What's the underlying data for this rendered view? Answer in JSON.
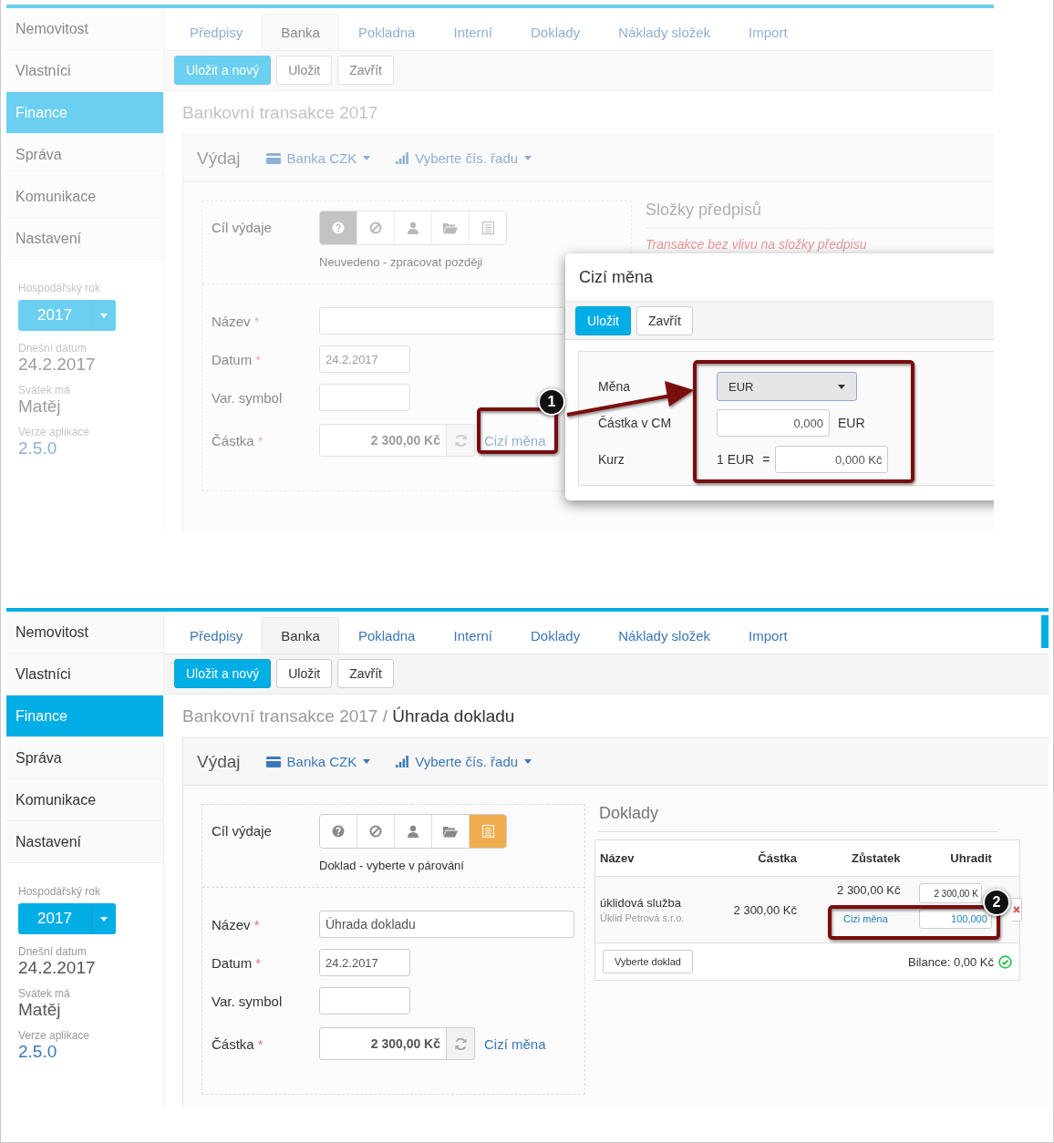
{
  "screens": [
    {
      "sidebar": {
        "items": [
          {
            "label": "Nemovitost",
            "selected": false
          },
          {
            "label": "Vlastníci",
            "selected": false
          },
          {
            "label": "Finance",
            "selected": true
          },
          {
            "label": "Správa",
            "selected": false
          },
          {
            "label": "Komunikace",
            "selected": false
          },
          {
            "label": "Nastavení",
            "selected": false
          }
        ],
        "year_label": "Hospodářský rok",
        "year": "2017",
        "info": [
          {
            "label": "Dnešní datum",
            "value": "24.2.2017",
            "kind": "plain"
          },
          {
            "label": "Svátek má",
            "value": "Matěj",
            "kind": "plain"
          },
          {
            "label": "Verze aplikace",
            "value": "2.5.0",
            "kind": "link"
          }
        ]
      },
      "tabs": [
        {
          "label": "Předpisy",
          "selected": false
        },
        {
          "label": "Banka",
          "selected": true
        },
        {
          "label": "Pokladna",
          "selected": false
        },
        {
          "label": "Interní",
          "selected": false
        },
        {
          "label": "Doklady",
          "selected": false
        },
        {
          "label": "Náklady složek",
          "selected": false
        },
        {
          "label": "Import",
          "selected": false
        }
      ],
      "toolbar": [
        {
          "label": "Uložit a nový",
          "kind": "primary"
        },
        {
          "label": "Uložit",
          "kind": "default"
        },
        {
          "label": "Zavřít",
          "kind": "default"
        }
      ],
      "breadcrumb": [
        {
          "text": "Bankovní transakce 2017",
          "kind": "parent"
        }
      ],
      "panel_header": {
        "title": "Výdaj",
        "bank": "Banka CZK",
        "series": "Vyberte čís. řadu"
      },
      "target": {
        "label": "Cíl výdaje",
        "options": [
          {
            "kind": "question",
            "selected": true
          },
          {
            "kind": "ban",
            "selected": false
          },
          {
            "kind": "person",
            "selected": false
          },
          {
            "kind": "folder",
            "selected": false
          },
          {
            "kind": "list",
            "selected": false
          }
        ],
        "note": "Neuvedeno - zpracovat později"
      },
      "fields": [
        {
          "label": "Název",
          "required_mark": "*",
          "kind": "wide"
        },
        {
          "label": "Datum",
          "required_mark": "*",
          "value": "24.2.2017",
          "kind": "short"
        },
        {
          "label": "Var. symbol",
          "kind": "short"
        },
        {
          "label": "Částka",
          "required_mark": "*",
          "value": "2 300,00 Kč",
          "kind": "amount",
          "link": "Cizí měna"
        }
      ],
      "right": {
        "kind": "components",
        "title": "Složky předpisů",
        "note": "Transakce bez vlivu na složky předpisu"
      },
      "modal": {
        "title": "Cizí měna",
        "buttons": [
          {
            "label": "Uložit",
            "kind": "primary"
          },
          {
            "label": "Zavřít",
            "kind": "default"
          }
        ],
        "currency_label": "Měna",
        "currency": "EUR",
        "amount_label": "Částka v CM",
        "amount": "0,000",
        "amount_unit": "EUR",
        "rate_label": "Kurz",
        "rate_prefix": "1 EUR",
        "rate_eq": "=",
        "rate": "0,000 Kč"
      }
    },
    {
      "sidebar": {
        "items": [
          {
            "label": "Nemovitost",
            "selected": false
          },
          {
            "label": "Vlastníci",
            "selected": false
          },
          {
            "label": "Finance",
            "selected": true
          },
          {
            "label": "Správa",
            "selected": false
          },
          {
            "label": "Komunikace",
            "selected": false
          },
          {
            "label": "Nastavení",
            "selected": false
          }
        ],
        "year_label": "Hospodářský rok",
        "year": "2017",
        "info": [
          {
            "label": "Dnešní datum",
            "value": "24.2.2017",
            "kind": "plain"
          },
          {
            "label": "Svátek má",
            "value": "Matěj",
            "kind": "plain"
          },
          {
            "label": "Verze aplikace",
            "value": "2.5.0",
            "kind": "link"
          }
        ]
      },
      "tabs": [
        {
          "label": "Předpisy",
          "selected": false
        },
        {
          "label": "Banka",
          "selected": true
        },
        {
          "label": "Pokladna",
          "selected": false
        },
        {
          "label": "Interní",
          "selected": false
        },
        {
          "label": "Doklady",
          "selected": false
        },
        {
          "label": "Náklady složek",
          "selected": false
        },
        {
          "label": "Import",
          "selected": false
        }
      ],
      "toolbar": [
        {
          "label": "Uložit a nový",
          "kind": "primary"
        },
        {
          "label": "Uložit",
          "kind": "default"
        },
        {
          "label": "Zavřít",
          "kind": "default"
        }
      ],
      "breadcrumb": [
        {
          "text": "Bankovní transakce 2017",
          "kind": "parent"
        },
        {
          "text": "/",
          "kind": "separator"
        },
        {
          "text": "Úhrada dokladu",
          "kind": "current"
        }
      ],
      "panel_header": {
        "title": "Výdaj",
        "bank": "Banka CZK",
        "series": "Vyberte čís. řadu"
      },
      "target": {
        "label": "Cíl výdaje",
        "options": [
          {
            "kind": "question",
            "selected": false
          },
          {
            "kind": "ban",
            "selected": false
          },
          {
            "kind": "person",
            "selected": false
          },
          {
            "kind": "folder",
            "selected": false
          },
          {
            "kind": "list",
            "selected": true
          }
        ],
        "note": "Doklad - vyberte v párování"
      },
      "fields": [
        {
          "label": "Název",
          "required_mark": "*",
          "value": "Úhrada dokladu",
          "kind": "wide"
        },
        {
          "label": "Datum",
          "required_mark": "*",
          "value": "24.2.2017",
          "kind": "short"
        },
        {
          "label": "Var. symbol",
          "kind": "short"
        },
        {
          "label": "Částka",
          "required_mark": "*",
          "value": "2 300,00 Kč",
          "kind": "amount",
          "link": "Cizí měna"
        }
      ],
      "right": {
        "kind": "documents",
        "title": "Doklady",
        "columns": [
          "Název",
          "Částka",
          "Zůstatek",
          "Uhradit"
        ],
        "rows": [
          {
            "name": "úklidová služba",
            "supplier": "Úklid Petrová s.r.o.",
            "amount": "2 300,00 Kč",
            "remaining": "2 300,00 Kč",
            "pay": "2 300,00 K",
            "foreign_link": "Cizi měna",
            "foreign_amount": "100,000"
          }
        ],
        "select_button": "Vyberte doklad",
        "balance": "Bilance: 0,00 Kč"
      }
    }
  ],
  "annotations": [
    {
      "label": "1"
    },
    {
      "label": "2"
    }
  ]
}
